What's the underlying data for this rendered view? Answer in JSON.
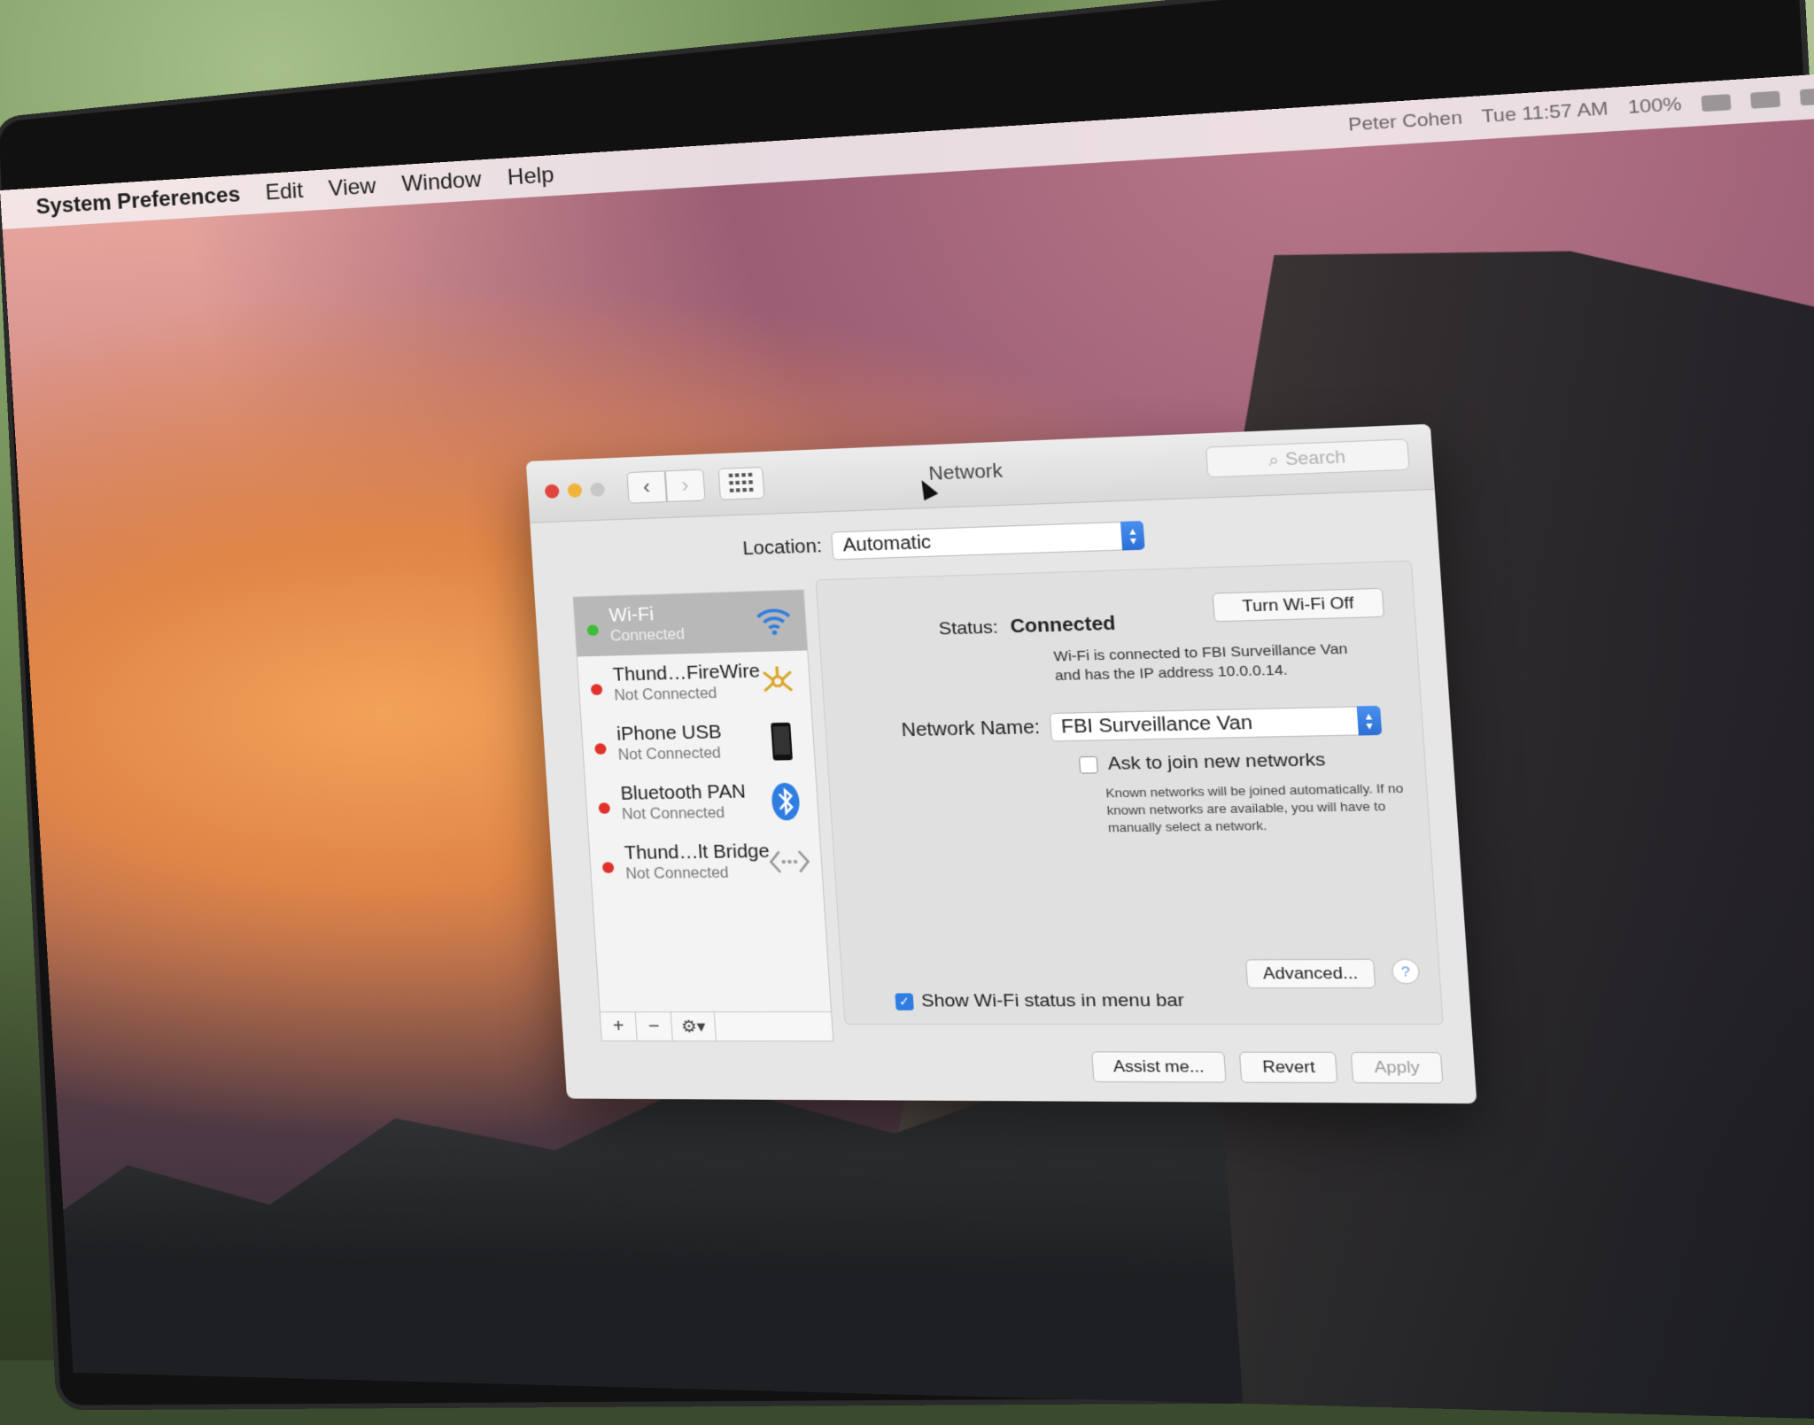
{
  "menubar": {
    "app": "System Preferences",
    "menus": [
      "Edit",
      "View",
      "Window",
      "Help"
    ],
    "user": "Peter Cohen",
    "clock": "Tue 11:57 AM",
    "battery": "100%"
  },
  "window": {
    "title": "Network",
    "search_placeholder": "Search",
    "location_label": "Location:",
    "location_value": "Automatic"
  },
  "services": [
    {
      "name": "Wi-Fi",
      "status": "Connected",
      "state": "green",
      "icon": "wifi-icon",
      "selected": true
    },
    {
      "name": "Thund…FireWire",
      "status": "Not Connected",
      "state": "red",
      "icon": "firewire-icon"
    },
    {
      "name": "iPhone USB",
      "status": "Not Connected",
      "state": "red",
      "icon": "iphone-icon"
    },
    {
      "name": "Bluetooth PAN",
      "status": "Not Connected",
      "state": "red",
      "icon": "bluetooth-icon"
    },
    {
      "name": "Thund…lt Bridge",
      "status": "Not Connected",
      "state": "red",
      "icon": "bridge-icon"
    }
  ],
  "detail": {
    "status_label": "Status:",
    "status_value": "Connected",
    "turn_off_label": "Turn Wi-Fi Off",
    "status_desc": "Wi-Fi is connected to FBI Surveillance Van and has the IP address 10.0.0.14.",
    "network_name_label": "Network Name:",
    "network_name_value": "FBI Surveillance Van",
    "ask_join_label": "Ask to join new networks",
    "ask_join_desc": "Known networks will be joined automatically. If no known networks are available, you will have to manually select a network.",
    "show_wifi_label": "Show Wi-Fi status in menu bar",
    "advanced_label": "Advanced...",
    "help_label": "?"
  },
  "footer": {
    "assist": "Assist me...",
    "revert": "Revert",
    "apply": "Apply"
  },
  "colors": {
    "accent": "#2f7de1",
    "connected": "#3fbd3a",
    "not_connected": "#e0312b"
  }
}
